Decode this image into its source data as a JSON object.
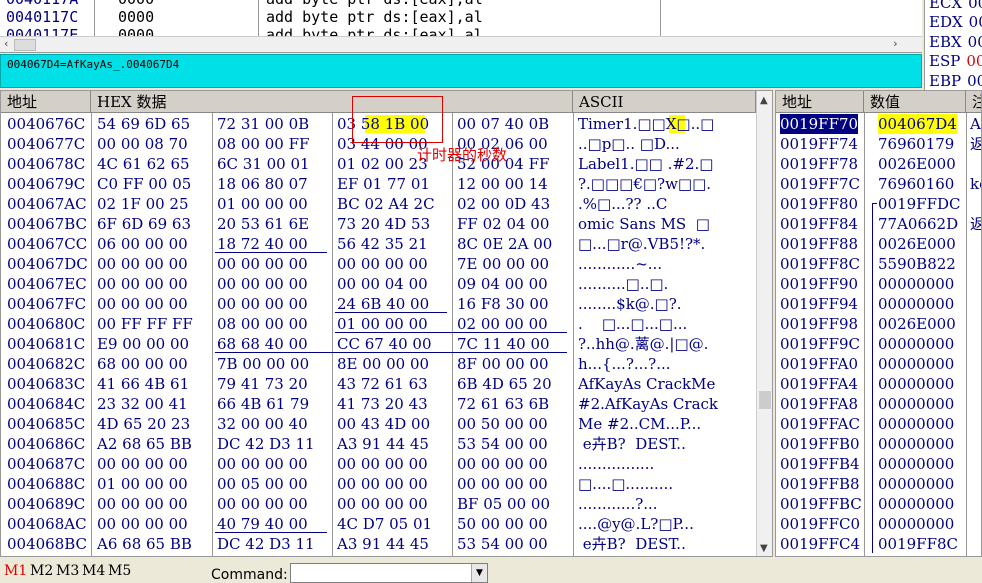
{
  "disasm": {
    "lines": [
      {
        "addr": "0040117A",
        "bytes": "0000",
        "instr": "add byte ptr ds:[eax],al"
      },
      {
        "addr": "0040117C",
        "bytes": "0000",
        "instr": "add byte ptr ds:[eax],al"
      },
      {
        "addr": "0040117E",
        "bytes": "0000",
        "instr": "add byte ptr ds:[eax],al"
      }
    ]
  },
  "registers": [
    {
      "name": "ECX",
      "value": "00"
    },
    {
      "name": "EDX",
      "value": "00"
    },
    {
      "name": "EBX",
      "value": "00"
    },
    {
      "name": "ESP",
      "value": "00"
    },
    {
      "name": "EBP",
      "value": "00"
    }
  ],
  "info": {
    "text": "004067D4=AfKayAs_.004067D4"
  },
  "dump": {
    "headers": {
      "addr": "地址",
      "hex": "HEX 数据",
      "ascii": "ASCII"
    },
    "annotation": "计时器的秒数",
    "rows": [
      {
        "addr": "0040676C",
        "g": [
          "54 69 6D 65",
          "72 31 00 0B",
          "03 58 1B 00",
          "00 07 40 0B"
        ],
        "ascii": "Timer1.□□X□..□"
      },
      {
        "addr": "0040677C",
        "g": [
          "00 00 08 70",
          "08 00 00 FF",
          "03 44 00 00",
          "00 02 06 00"
        ],
        "ascii": "..□p□.. □D..."
      },
      {
        "addr": "0040678C",
        "g": [
          "4C 61 62 65",
          "6C 31 00 01",
          "01 02 00 23",
          "52 00 04 FF"
        ],
        "ascii": "Label1.□□ .#2.□"
      },
      {
        "addr": "0040679C",
        "g": [
          "C0 FF 00 05",
          "18 06 80 07",
          "EF 01 77 01",
          "12 00 00 14"
        ],
        "ascii": "?.□□□€□?w□□."
      },
      {
        "addr": "004067AC",
        "g": [
          "02 1F 00 25",
          "01 00 00 00",
          "BC 02 A4 2C",
          "02 00 0D 43"
        ],
        "ascii": ".%□...?? ..C"
      },
      {
        "addr": "004067BC",
        "g": [
          "6F 6D 69 63",
          "20 53 61 6E",
          "73 20 4D 53",
          "FF 02 04 00"
        ],
        "ascii": "omic Sans MS  □"
      },
      {
        "addr": "004067CC",
        "g": [
          "06 00 00 00",
          "18 72 40 00",
          "56 42 35 21",
          "8C 0E 2A 00"
        ],
        "ascii": "□...□r@.VB5!?*."
      },
      {
        "addr": "004067DC",
        "g": [
          "00 00 00 00",
          "00 00 00 00",
          "00 00 00 00",
          "7E 00 00 00"
        ],
        "ascii": "............~..."
      },
      {
        "addr": "004067EC",
        "g": [
          "00 00 00 00",
          "00 00 00 00",
          "00 00 04 00",
          "09 04 00 00"
        ],
        "ascii": "..........□..□."
      },
      {
        "addr": "004067FC",
        "g": [
          "00 00 00 00",
          "00 00 00 00",
          "24 6B 40 00",
          "16 F8 30 00"
        ],
        "ascii": "........$k@.□?."
      },
      {
        "addr": "0040680C",
        "g": [
          "00 FF FF FF",
          "08 00 00 00",
          "01 00 00 00",
          "02 00 00 00"
        ],
        "ascii": ".    □...□...□..."
      },
      {
        "addr": "0040681C",
        "g": [
          "E9 00 00 00",
          "68 68 40 00",
          "CC 67 40 00",
          "7C 11 40 00"
        ],
        "ascii": "?..hh@.蓠@.|□@."
      },
      {
        "addr": "0040682C",
        "g": [
          "68 00 00 00",
          "7B 00 00 00",
          "8E 00 00 00",
          "8F 00 00 00"
        ],
        "ascii": "h...{...?...?..."
      },
      {
        "addr": "0040683C",
        "g": [
          "41 66 4B 61",
          "79 41 73 20",
          "43 72 61 63",
          "6B 4D 65 20"
        ],
        "ascii": "AfKayAs CrackMe "
      },
      {
        "addr": "0040684C",
        "g": [
          "23 32 00 41",
          "66 4B 61 79",
          "41 73 20 43",
          "72 61 63 6B"
        ],
        "ascii": "#2.AfKayAs Crack"
      },
      {
        "addr": "0040685C",
        "g": [
          "4D 65 20 23",
          "32 00 00 40",
          "00 43 4D 00",
          "00 50 00 00"
        ],
        "ascii": "Me #2..CM...P..."
      },
      {
        "addr": "0040686C",
        "g": [
          "A2 68 65 BB",
          "DC 42 D3 11",
          "A3 91 44 45",
          "53 54 00 00"
        ],
        "ascii": " e卉B?  DEST.."
      },
      {
        "addr": "0040687C",
        "g": [
          "00 00 00 00",
          "00 00 00 00",
          "00 00 00 00",
          "00 00 00 00"
        ],
        "ascii": "................"
      },
      {
        "addr": "0040688C",
        "g": [
          "01 00 00 00",
          "00 05 00 00",
          "00 00 00 00",
          "00 00 00 00"
        ],
        "ascii": "□....□.........."
      },
      {
        "addr": "0040689C",
        "g": [
          "00 00 00 00",
          "00 00 00 00",
          "00 00 00 00",
          "BF 05 00 00"
        ],
        "ascii": "............?..."
      },
      {
        "addr": "004068AC",
        "g": [
          "00 00 00 00",
          "40 79 40 00",
          "4C D7 05 01",
          "50 00 00 00"
        ],
        "ascii": "....@y@.L?□P..."
      },
      {
        "addr": "004068BC",
        "g": [
          "A6 68 65 BB",
          "DC 42 D3 11",
          "A3 91 44 45",
          "53 54 00 00"
        ],
        "ascii": " e卉B?  DEST.."
      }
    ]
  },
  "stack": {
    "headers": {
      "addr": "地址",
      "value": "数值",
      "comment": "注"
    },
    "rows": [
      {
        "addr": "0019FF70",
        "value": "004067D4",
        "comment": "A"
      },
      {
        "addr": "0019FF74",
        "value": "76960179",
        "comment": "返"
      },
      {
        "addr": "0019FF78",
        "value": "0026E000",
        "comment": ""
      },
      {
        "addr": "0019FF7C",
        "value": "76960160",
        "comment": "ke"
      },
      {
        "addr": "0019FF80",
        "value": "0019FFDC",
        "comment": ""
      },
      {
        "addr": "0019FF84",
        "value": "77A0662D",
        "comment": "返"
      },
      {
        "addr": "0019FF88",
        "value": "0026E000",
        "comment": ""
      },
      {
        "addr": "0019FF8C",
        "value": "5590B822",
        "comment": ""
      },
      {
        "addr": "0019FF90",
        "value": "00000000",
        "comment": ""
      },
      {
        "addr": "0019FF94",
        "value": "00000000",
        "comment": ""
      },
      {
        "addr": "0019FF98",
        "value": "0026E000",
        "comment": ""
      },
      {
        "addr": "0019FF9C",
        "value": "00000000",
        "comment": ""
      },
      {
        "addr": "0019FFA0",
        "value": "00000000",
        "comment": ""
      },
      {
        "addr": "0019FFA4",
        "value": "00000000",
        "comment": ""
      },
      {
        "addr": "0019FFA8",
        "value": "00000000",
        "comment": ""
      },
      {
        "addr": "0019FFAC",
        "value": "00000000",
        "comment": ""
      },
      {
        "addr": "0019FFB0",
        "value": "00000000",
        "comment": ""
      },
      {
        "addr": "0019FFB4",
        "value": "00000000",
        "comment": ""
      },
      {
        "addr": "0019FFB8",
        "value": "00000000",
        "comment": ""
      },
      {
        "addr": "0019FFBC",
        "value": "00000000",
        "comment": ""
      },
      {
        "addr": "0019FFC0",
        "value": "00000000",
        "comment": ""
      },
      {
        "addr": "0019FFC4",
        "value": "0019FF8C",
        "comment": ""
      }
    ]
  },
  "bottom": {
    "tabs": [
      "M1",
      "M2",
      "M3",
      "M4",
      "M5"
    ],
    "command_label": "Command:",
    "command_value": ""
  },
  "colors": {
    "active_tab": "#e00000",
    "highlight": "#ffff00",
    "annotation": "#e00000",
    "info_bg": "#00e0e6"
  }
}
